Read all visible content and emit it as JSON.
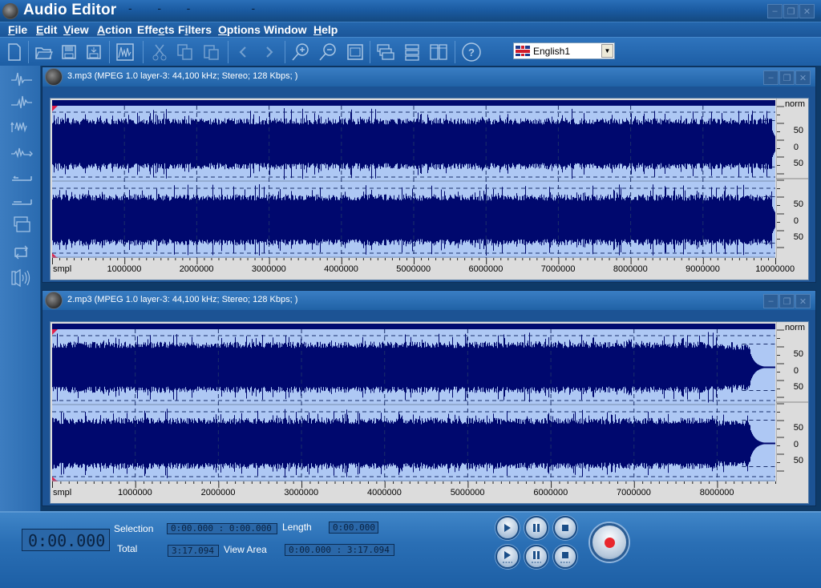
{
  "app": {
    "title": "Audio Editor",
    "title_dashes": "-   -   -        -"
  },
  "window_controls": {
    "minimize": "minimize-icon",
    "restore": "restore-icon",
    "close": "close-icon"
  },
  "menu": [
    {
      "label": "File",
      "accel": "F",
      "rest": "ile"
    },
    {
      "label": "Edit",
      "accel": "E",
      "rest": "dit"
    },
    {
      "label": "View",
      "accel": "V",
      "rest": "iew"
    },
    {
      "label": "Action",
      "accel": "A",
      "rest": "ction"
    },
    {
      "label": "Effects",
      "pre": "Effe",
      "accel": "c",
      "rest": "ts"
    },
    {
      "label": "Filters",
      "pre": "F",
      "accel": "i",
      "rest": "lters"
    },
    {
      "label": "Options",
      "accel": "O",
      "rest": "ptions"
    },
    {
      "label": "Window",
      "pre": "Window",
      "accel": "",
      "rest": ""
    },
    {
      "label": "Help",
      "accel": "H",
      "rest": "elp"
    }
  ],
  "toolbar": {
    "buttons": [
      "new-file",
      "open",
      "save",
      "save-as",
      "spectrum",
      "cut",
      "copy",
      "paste",
      "undo",
      "redo",
      "zoom-in",
      "zoom-out",
      "fit-window",
      "cascade",
      "tile-horizontal",
      "tile-vertical",
      "help"
    ],
    "language": {
      "value": "English1",
      "flag": "uk-flag"
    }
  },
  "sidebar": {
    "tools": [
      "waveform-generate",
      "waveform-amplify",
      "waveform-normalize",
      "waveform-fade",
      "fade-in",
      "fade-out",
      "mix",
      "loop",
      "volume"
    ]
  },
  "documents": [
    {
      "title": "3.mp3 (MPEG 1.0 layer-3: 44,100 kHz; Stereo; 128 Kbps; )",
      "scale_label": "norm",
      "channel_scale": [
        "50",
        "0",
        "50"
      ],
      "ruler_unit": "smpl",
      "ruler_ticks": [
        "1000000",
        "2000000",
        "3000000",
        "4000000",
        "5000000",
        "6000000",
        "7000000",
        "8000000",
        "9000000",
        "10000000"
      ],
      "total_samples": 10000000,
      "audio_end_fraction": 0.995,
      "seed": 7
    },
    {
      "title": "2.mp3 (MPEG 1.0 layer-3: 44,100 kHz; Stereo; 128 Kbps; )",
      "scale_label": "norm",
      "channel_scale": [
        "50",
        "0",
        "50"
      ],
      "ruler_unit": "smpl",
      "ruler_ticks": [
        "1000000",
        "2000000",
        "3000000",
        "4000000",
        "5000000",
        "6000000",
        "7000000",
        "8000000"
      ],
      "total_samples": 8700000,
      "audio_end_fraction": 0.965,
      "seed": 13
    }
  ],
  "status": {
    "position": "0:00.000",
    "selection_label": "Selection",
    "selection_value": "0:00.000 :  0:00.000",
    "length_label": "Length",
    "length_value": "0:00.000",
    "total_label": "Total",
    "total_value": "3:17.094",
    "view_area_label": "View Area",
    "view_area_value": "0:00.000 :  3:17.094"
  },
  "transport": {
    "row1": [
      "play",
      "pause",
      "stop"
    ],
    "row2": [
      "play-loop",
      "pause-loop",
      "stop-loop"
    ],
    "record": "record"
  }
}
